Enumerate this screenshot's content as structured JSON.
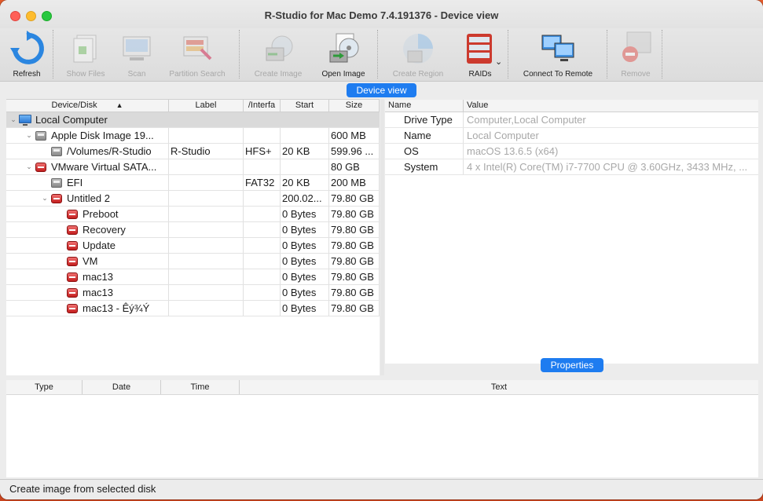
{
  "window": {
    "title": "R-Studio for Mac Demo 7.4.191376 - Device view"
  },
  "toolbar": {
    "refresh": "Refresh",
    "show_files": "Show Files",
    "scan": "Scan",
    "partition_search": "Partition Search",
    "create_image": "Create Image",
    "open_image": "Open Image",
    "create_region": "Create Region",
    "raids": "RAIDs",
    "connect_remote": "Connect To Remote",
    "remove": "Remove"
  },
  "sections": {
    "device_view": "Device view",
    "properties": "Properties"
  },
  "device_table": {
    "headers": [
      "Device/Disk",
      "Label",
      "/Interfa",
      "Start",
      "Size"
    ],
    "rows": [
      {
        "name": "Local Computer",
        "label": "",
        "fs": "",
        "start": "",
        "size": ""
      },
      {
        "name": "Apple Disk Image 19...",
        "label": "",
        "fs": "",
        "start": "",
        "size": "600 MB"
      },
      {
        "name": "/Volumes/R-Studio",
        "label": "R-Studio",
        "fs": "HFS+",
        "start": "20 KB",
        "size": "599.96 ..."
      },
      {
        "name": "VMware Virtual SATA...",
        "label": "",
        "fs": "",
        "start": "",
        "size": "80 GB"
      },
      {
        "name": "EFI",
        "label": "",
        "fs": "FAT32",
        "start": "20 KB",
        "size": "200 MB"
      },
      {
        "name": "Untitled 2",
        "label": "",
        "fs": "",
        "start": "200.02...",
        "size": "79.80 GB"
      },
      {
        "name": "Preboot",
        "label": "",
        "fs": "",
        "start": "0 Bytes",
        "size": "79.80 GB"
      },
      {
        "name": "Recovery",
        "label": "",
        "fs": "",
        "start": "0 Bytes",
        "size": "79.80 GB"
      },
      {
        "name": "Update",
        "label": "",
        "fs": "",
        "start": "0 Bytes",
        "size": "79.80 GB"
      },
      {
        "name": "VM",
        "label": "",
        "fs": "",
        "start": "0 Bytes",
        "size": "79.80 GB"
      },
      {
        "name": "mac13",
        "label": "",
        "fs": "",
        "start": "0 Bytes",
        "size": "79.80 GB"
      },
      {
        "name": "mac13",
        "label": "",
        "fs": "",
        "start": "0 Bytes",
        "size": "79.80 GB"
      },
      {
        "name": "mac13 - Êý¾Ý",
        "label": "",
        "fs": "",
        "start": "0 Bytes",
        "size": "79.80 GB"
      }
    ]
  },
  "properties": {
    "headers": [
      "Name",
      "Value"
    ],
    "rows": [
      {
        "name": "Drive Type",
        "value": "Computer,Local Computer"
      },
      {
        "name": "Name",
        "value": "Local Computer"
      },
      {
        "name": "OS",
        "value": "macOS 13.6.5 (x64)"
      },
      {
        "name": "System",
        "value": "4 x Intel(R) Core(TM) i7-7700 CPU @ 3.60GHz, 3433 MHz, ..."
      }
    ]
  },
  "log": {
    "headers": [
      "Type",
      "Date",
      "Time",
      "Text"
    ]
  },
  "status": {
    "text": "Create image from selected disk"
  },
  "colors": {
    "accent": "#1e7cf0",
    "disabled_text": "#a8a8a8"
  }
}
